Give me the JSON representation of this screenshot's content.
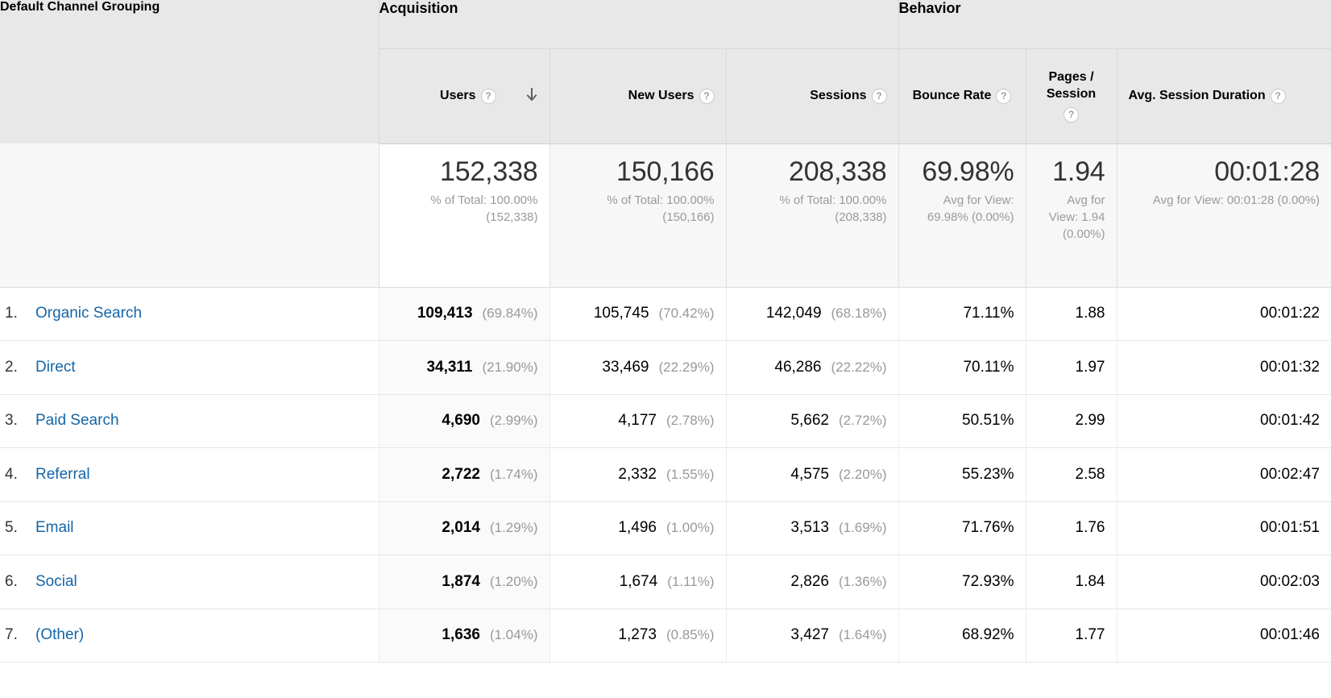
{
  "table": {
    "dimension_header": "Default Channel Grouping",
    "group_headers": {
      "acquisition": "Acquisition",
      "behavior": "Behavior"
    },
    "sort": {
      "column": "Users",
      "direction": "descending",
      "icon": "arrow-down-icon"
    },
    "help_icon_glyph": "?",
    "columns": [
      {
        "key": "users",
        "label": "Users",
        "group": "Acquisition",
        "has_help": true,
        "sorted": true
      },
      {
        "key": "newu",
        "label": "New Users",
        "group": "Acquisition",
        "has_help": true,
        "sorted": false
      },
      {
        "key": "sess",
        "label": "Sessions",
        "group": "Acquisition",
        "has_help": true,
        "sorted": false
      },
      {
        "key": "bounce",
        "label": "Bounce Rate",
        "group": "Behavior",
        "has_help": true,
        "sorted": false
      },
      {
        "key": "pages",
        "label": "Pages / Session",
        "group": "Behavior",
        "has_help": true,
        "sorted": false
      },
      {
        "key": "avgdur",
        "label": "Avg. Session Duration",
        "group": "Behavior",
        "has_help": true,
        "sorted": false
      }
    ],
    "summary": {
      "users": {
        "value": "152,338",
        "sub": "% of Total: 100.00% (152,338)"
      },
      "newu": {
        "value": "150,166",
        "sub": "% of Total: 100.00% (150,166)"
      },
      "sess": {
        "value": "208,338",
        "sub": "% of Total: 100.00% (208,338)"
      },
      "bounce": {
        "value": "69.98%",
        "sub": "Avg for View: 69.98% (0.00%)"
      },
      "pages": {
        "value": "1.94",
        "sub": "Avg for View: 1.94 (0.00%)"
      },
      "avgdur": {
        "value": "00:01:28",
        "sub": "Avg for View: 00:01:28 (0.00%)"
      }
    },
    "rows": [
      {
        "num": "1.",
        "name": "Organic Search",
        "users": "109,413",
        "users_pct": "(69.84%)",
        "newu": "105,745",
        "newu_pct": "(70.42%)",
        "sess": "142,049",
        "sess_pct": "(68.18%)",
        "bounce": "71.11%",
        "pages": "1.88",
        "avgdur": "00:01:22"
      },
      {
        "num": "2.",
        "name": "Direct",
        "users": "34,311",
        "users_pct": "(21.90%)",
        "newu": "33,469",
        "newu_pct": "(22.29%)",
        "sess": "46,286",
        "sess_pct": "(22.22%)",
        "bounce": "70.11%",
        "pages": "1.97",
        "avgdur": "00:01:32"
      },
      {
        "num": "3.",
        "name": "Paid Search",
        "users": "4,690",
        "users_pct": "(2.99%)",
        "newu": "4,177",
        "newu_pct": "(2.78%)",
        "sess": "5,662",
        "sess_pct": "(2.72%)",
        "bounce": "50.51%",
        "pages": "2.99",
        "avgdur": "00:01:42"
      },
      {
        "num": "4.",
        "name": "Referral",
        "users": "2,722",
        "users_pct": "(1.74%)",
        "newu": "2,332",
        "newu_pct": "(1.55%)",
        "sess": "4,575",
        "sess_pct": "(2.20%)",
        "bounce": "55.23%",
        "pages": "2.58",
        "avgdur": "00:02:47"
      },
      {
        "num": "5.",
        "name": "Email",
        "users": "2,014",
        "users_pct": "(1.29%)",
        "newu": "1,496",
        "newu_pct": "(1.00%)",
        "sess": "3,513",
        "sess_pct": "(1.69%)",
        "bounce": "71.76%",
        "pages": "1.76",
        "avgdur": "00:01:51"
      },
      {
        "num": "6.",
        "name": "Social",
        "users": "1,874",
        "users_pct": "(1.20%)",
        "newu": "1,674",
        "newu_pct": "(1.11%)",
        "sess": "2,826",
        "sess_pct": "(1.36%)",
        "bounce": "72.93%",
        "pages": "1.84",
        "avgdur": "00:02:03"
      },
      {
        "num": "7.",
        "name": "(Other)",
        "users": "1,636",
        "users_pct": "(1.04%)",
        "newu": "1,273",
        "newu_pct": "(0.85%)",
        "sess": "3,427",
        "sess_pct": "(1.64%)",
        "bounce": "68.92%",
        "pages": "1.77",
        "avgdur": "00:01:46"
      }
    ]
  },
  "colors": {
    "link": "#1565a8",
    "header_bg": "#e8e8e8",
    "summary_bg": "#f7f7f7",
    "sorted_col_bg": "#fafafa",
    "muted_text": "#999999"
  }
}
